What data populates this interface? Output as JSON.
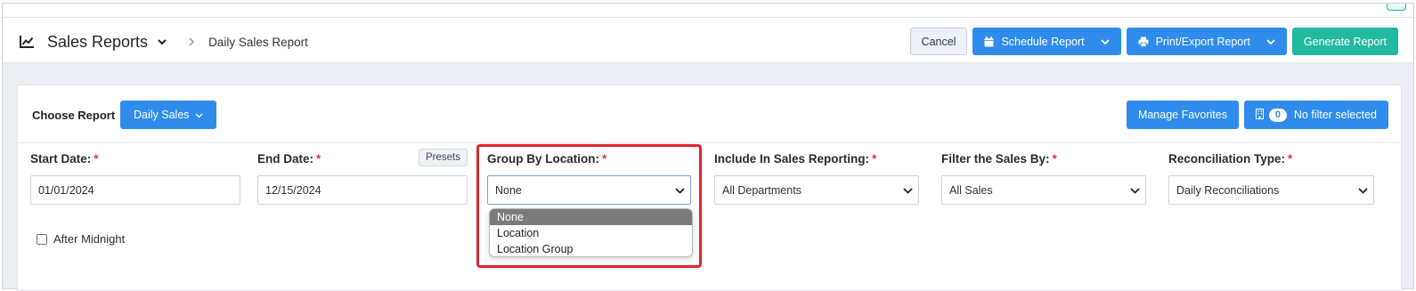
{
  "header": {
    "title": "Sales Reports",
    "breadcrumb_current": "Daily Sales Report",
    "actions": {
      "cancel": "Cancel",
      "schedule": "Schedule Report",
      "print_export": "Print/Export Report",
      "generate": "Generate Report"
    }
  },
  "report_chooser": {
    "label": "Choose Report",
    "selected": "Daily Sales"
  },
  "toolbar_right": {
    "manage_favorites": "Manage Favorites",
    "filter_count": "0",
    "filter_text": "No filter selected"
  },
  "fields": {
    "start_date": {
      "label": "Start Date:",
      "required": "*",
      "value": "01/01/2024"
    },
    "end_date": {
      "label": "End Date:",
      "required": "*",
      "value": "12/15/2024",
      "presets": "Presets"
    },
    "group_by_location": {
      "label": "Group By Location:",
      "required": "*",
      "value": "None",
      "options": [
        "None",
        "Location",
        "Location Group"
      ]
    },
    "include_in_sales": {
      "label": "Include In Sales Reporting:",
      "required": "*",
      "value": "All Departments"
    },
    "filter_sales_by": {
      "label": "Filter the Sales By:",
      "required": "*",
      "value": "All Sales"
    },
    "reconciliation_type": {
      "label": "Reconciliation Type:",
      "required": "*",
      "value": "Daily Reconciliations"
    }
  },
  "after_midnight": {
    "label": "After Midnight",
    "checked": false
  },
  "colors": {
    "primary_blue": "#2f8cec",
    "teal": "#21b9a0",
    "required_red": "#e0383e",
    "highlight_red": "#e0282e"
  }
}
